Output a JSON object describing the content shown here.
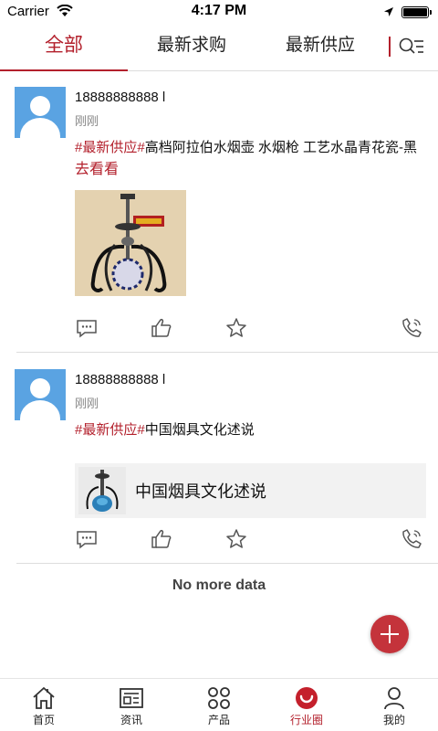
{
  "status_bar": {
    "carrier": "Carrier",
    "time": "4:17 PM"
  },
  "tabs": [
    {
      "label": "全部",
      "active": true
    },
    {
      "label": "最新求购",
      "active": false
    },
    {
      "label": "最新供应",
      "active": false
    }
  ],
  "posts": [
    {
      "username": "18888888888 l",
      "time": "刚刚",
      "tag": "#最新供应#",
      "text": "高档阿拉伯水烟壶 水烟枪 工艺水晶青花瓷-黑",
      "more": "去看看",
      "has_image": true
    },
    {
      "username": "18888888888 l",
      "time": "刚刚",
      "tag": "#最新供应#",
      "text": "中国烟具文化述说",
      "link_card_title": "中国烟具文化述说"
    }
  ],
  "footer": {
    "no_more": "No more data"
  },
  "bottom_nav": [
    {
      "label": "首页",
      "icon": "home-icon",
      "active": false
    },
    {
      "label": "资讯",
      "icon": "news-icon",
      "active": false
    },
    {
      "label": "产品",
      "icon": "products-icon",
      "active": false
    },
    {
      "label": "行业圈",
      "icon": "industry-circle-icon",
      "active": true
    },
    {
      "label": "我的",
      "icon": "profile-icon",
      "active": false
    }
  ],
  "colors": {
    "accent": "#b3202c",
    "avatar": "#5aa3e2",
    "fab": "#c4333b"
  }
}
